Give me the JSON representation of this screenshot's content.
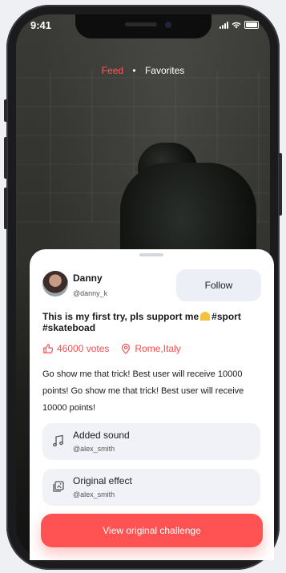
{
  "status": {
    "time": "9:41"
  },
  "feed_tabs": {
    "active": "Feed",
    "separator": "•",
    "other": "Favorites"
  },
  "user": {
    "name": "Danny",
    "handle": "@danny_k"
  },
  "follow_label": "Follow",
  "post": {
    "title_part1": "This is my first try, pls support me",
    "title_part2": "#sport #skateboad",
    "votes": "46000 votes",
    "location": "Rome,Italy",
    "description": "Go show me that trick! Best user will receive 10000 points! Go show me that trick! Best user will receive 10000 points!"
  },
  "cards": [
    {
      "title": "Added sound",
      "subtitle": "@alex_smith",
      "icon": "music-note-icon"
    },
    {
      "title": "Original effect",
      "subtitle": "@alex_smith",
      "icon": "effect-icon"
    }
  ],
  "cta_label": "View original challenge",
  "colors": {
    "accent": "#ff5252",
    "card_bg": "#f0f2f7",
    "follow_bg": "#eceff5"
  }
}
